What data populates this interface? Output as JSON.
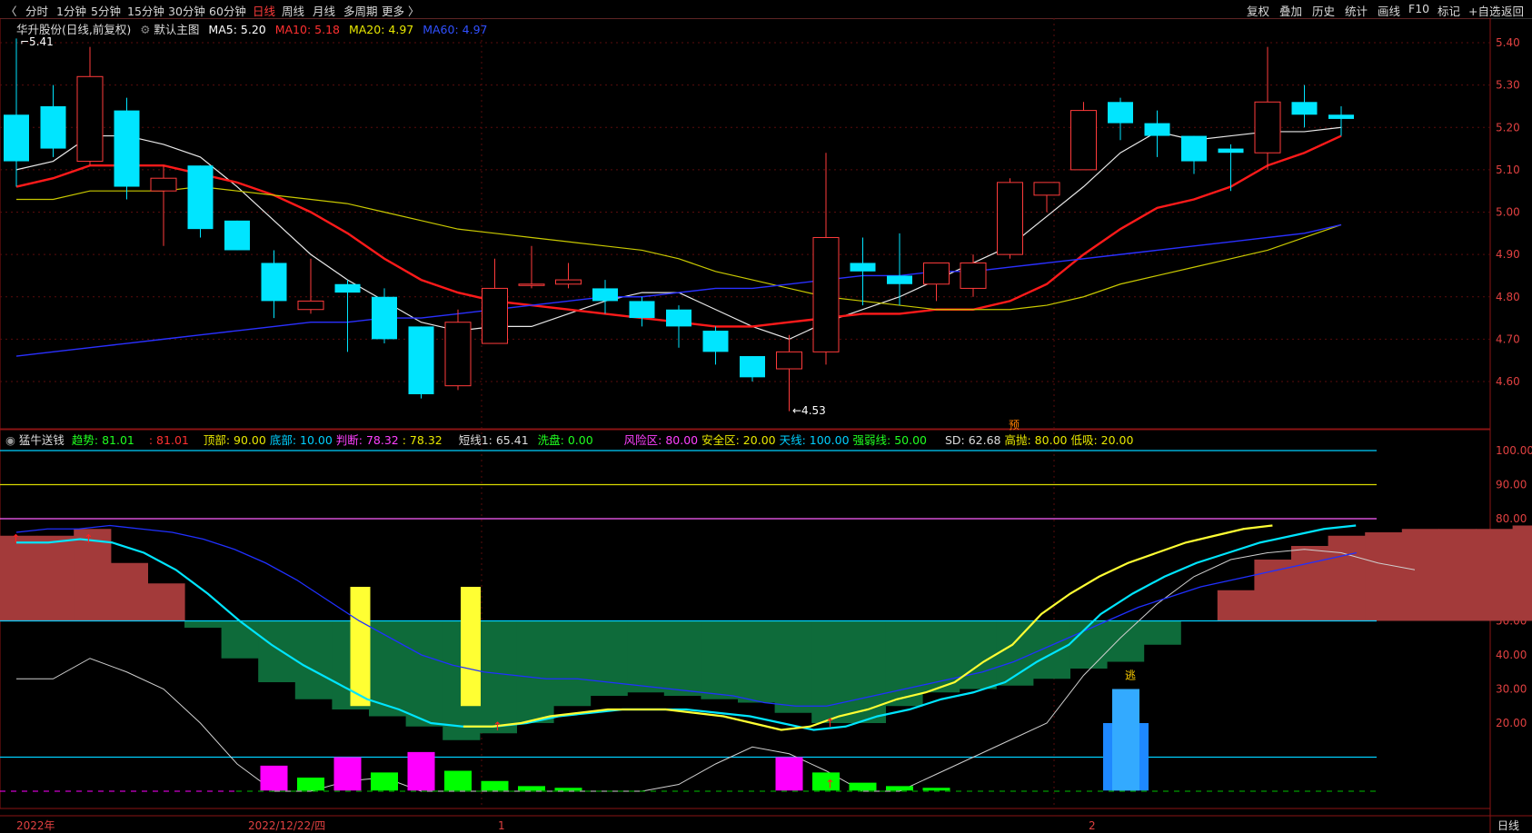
{
  "toolbar": {
    "tabs": [
      {
        "label": "分时",
        "active": false
      },
      {
        "label": "1分钟",
        "active": false
      },
      {
        "label": "5分钟",
        "active": false
      },
      {
        "label": "15分钟",
        "active": false
      },
      {
        "label": "30分钟",
        "active": false
      },
      {
        "label": "60分钟",
        "active": false
      },
      {
        "label": "日线",
        "active": true
      },
      {
        "label": "周线",
        "active": false
      },
      {
        "label": "月线",
        "active": false
      },
      {
        "label": "多周期",
        "active": false
      },
      {
        "label": "更多 〉",
        "active": false
      }
    ],
    "right_tabs": [
      "复权",
      "叠加",
      "历史",
      "统计",
      "画线",
      "F10",
      "标记",
      "+自选",
      "返回"
    ]
  },
  "header": {
    "stock_name": "华升股份(日线,前复权)",
    "chart_label": "默认主图",
    "ma5": "MA5: 5.20",
    "ma10": "MA10: 5.18",
    "ma20": "MA20: 4.97",
    "ma60": "MA60: 4.97"
  },
  "indicator_legend": {
    "name": "猛牛送钱",
    "trend": "趋势: 81.01",
    "trend2": ": 81.01",
    "top": "顶部: 90.00",
    "bottom": "底部: 10.00",
    "judge": "判断: 78.32",
    "judge2": ": 78.32",
    "short": "短线1: 65.41",
    "wash": "洗盘: 0.00",
    "risk": "风险区: 80.00",
    "safe": "安全区: 20.00",
    "sky": "天线: 100.00",
    "strongweak": "强弱线: 50.00",
    "sd": "SD: 62.68",
    "high": "高抛: 80.00",
    "low": "低吸: 20.00"
  },
  "annotations": {
    "high_label": "5.41",
    "low_label": "4.53",
    "yu_label": "预",
    "tao_label": "逃"
  },
  "bottom_axis": {
    "labels": [
      "2022年",
      "2022/12/22/四",
      "1",
      "2"
    ],
    "period": "日线"
  },
  "colors": {
    "up": "#ff3b3b",
    "down": "#00e5ff",
    "ma5": "#ffffff",
    "ma10": "#ff2020",
    "ma20": "#d8d800",
    "ma60": "#2030ff",
    "risk_fill": "#a33a3a",
    "safe_fill": "#0e6b3a",
    "grid": "#7a1010"
  },
  "chart_data": [
    {
      "type": "candlestick",
      "title": "华升股份(日线,前复权)",
      "ylim": [
        4.53,
        5.45
      ],
      "yticks": [
        4.6,
        4.7,
        4.8,
        4.9,
        5.0,
        5.1,
        5.2,
        5.3,
        5.4
      ],
      "candles": [
        {
          "o": 5.23,
          "h": 5.41,
          "l": 5.06,
          "c": 5.12
        },
        {
          "o": 5.25,
          "h": 5.3,
          "l": 5.13,
          "c": 5.15
        },
        {
          "o": 5.12,
          "h": 5.39,
          "l": 5.11,
          "c": 5.32
        },
        {
          "o": 5.24,
          "h": 5.27,
          "l": 5.03,
          "c": 5.06
        },
        {
          "o": 5.05,
          "h": 5.11,
          "l": 4.92,
          "c": 5.08
        },
        {
          "o": 5.11,
          "h": 5.11,
          "l": 4.94,
          "c": 4.96
        },
        {
          "o": 4.98,
          "h": 4.98,
          "l": 4.91,
          "c": 4.91
        },
        {
          "o": 4.88,
          "h": 4.91,
          "l": 4.75,
          "c": 4.79
        },
        {
          "o": 4.77,
          "h": 4.89,
          "l": 4.76,
          "c": 4.79
        },
        {
          "o": 4.83,
          "h": 4.84,
          "l": 4.67,
          "c": 4.81
        },
        {
          "o": 4.8,
          "h": 4.82,
          "l": 4.69,
          "c": 4.7
        },
        {
          "o": 4.73,
          "h": 4.73,
          "l": 4.56,
          "c": 4.57
        },
        {
          "o": 4.59,
          "h": 4.77,
          "l": 4.58,
          "c": 4.74
        },
        {
          "o": 4.69,
          "h": 4.89,
          "l": 4.69,
          "c": 4.82
        },
        {
          "o": 4.83,
          "h": 4.92,
          "l": 4.82,
          "c": 4.83
        },
        {
          "o": 4.83,
          "h": 4.88,
          "l": 4.82,
          "c": 4.84
        },
        {
          "o": 4.82,
          "h": 4.84,
          "l": 4.76,
          "c": 4.79
        },
        {
          "o": 4.79,
          "h": 4.8,
          "l": 4.73,
          "c": 4.75
        },
        {
          "o": 4.77,
          "h": 4.78,
          "l": 4.68,
          "c": 4.73
        },
        {
          "o": 4.72,
          "h": 4.73,
          "l": 4.64,
          "c": 4.67
        },
        {
          "o": 4.66,
          "h": 4.66,
          "l": 4.6,
          "c": 4.61
        },
        {
          "o": 4.63,
          "h": 4.71,
          "l": 4.53,
          "c": 4.67
        },
        {
          "o": 4.67,
          "h": 5.14,
          "l": 4.64,
          "c": 4.94
        },
        {
          "o": 4.88,
          "h": 4.94,
          "l": 4.78,
          "c": 4.86
        },
        {
          "o": 4.85,
          "h": 4.95,
          "l": 4.78,
          "c": 4.83
        },
        {
          "o": 4.83,
          "h": 4.88,
          "l": 4.79,
          "c": 4.88
        },
        {
          "o": 4.82,
          "h": 4.9,
          "l": 4.8,
          "c": 4.88
        },
        {
          "o": 4.9,
          "h": 5.08,
          "l": 4.89,
          "c": 5.07
        },
        {
          "o": 5.04,
          "h": 5.07,
          "l": 5.0,
          "c": 5.07
        },
        {
          "o": 5.1,
          "h": 5.26,
          "l": 5.1,
          "c": 5.24
        },
        {
          "o": 5.26,
          "h": 5.27,
          "l": 5.17,
          "c": 5.21
        },
        {
          "o": 5.21,
          "h": 5.24,
          "l": 5.13,
          "c": 5.18
        },
        {
          "o": 5.18,
          "h": 5.18,
          "l": 5.09,
          "c": 5.12
        },
        {
          "o": 5.15,
          "h": 5.16,
          "l": 5.05,
          "c": 5.14
        },
        {
          "o": 5.14,
          "h": 5.39,
          "l": 5.1,
          "c": 5.26
        },
        {
          "o": 5.26,
          "h": 5.3,
          "l": 5.2,
          "c": 5.23
        },
        {
          "o": 5.23,
          "h": 5.25,
          "l": 5.18,
          "c": 5.22
        }
      ],
      "series": [
        {
          "name": "MA5",
          "values": [
            5.1,
            5.12,
            5.18,
            5.18,
            5.16,
            5.13,
            5.06,
            4.98,
            4.9,
            4.84,
            4.79,
            4.74,
            4.72,
            4.73,
            4.73,
            4.76,
            4.79,
            4.81,
            4.81,
            4.77,
            4.73,
            4.7,
            4.74,
            4.77,
            4.8,
            4.84,
            4.88,
            4.92,
            4.99,
            5.06,
            5.14,
            5.19,
            5.17,
            5.18,
            5.19,
            5.19,
            5.2
          ]
        },
        {
          "name": "MA10",
          "values": [
            5.06,
            5.08,
            5.11,
            5.11,
            5.11,
            5.09,
            5.07,
            5.04,
            5.0,
            4.95,
            4.89,
            4.84,
            4.81,
            4.79,
            4.78,
            4.77,
            4.76,
            4.75,
            4.74,
            4.73,
            4.73,
            4.74,
            4.75,
            4.76,
            4.76,
            4.77,
            4.77,
            4.79,
            4.83,
            4.9,
            4.96,
            5.01,
            5.03,
            5.06,
            5.11,
            5.14,
            5.18
          ]
        },
        {
          "name": "MA20",
          "values": [
            5.03,
            5.03,
            5.05,
            5.05,
            5.05,
            5.06,
            5.05,
            5.04,
            5.03,
            5.02,
            5.0,
            4.98,
            4.96,
            4.95,
            4.94,
            4.93,
            4.92,
            4.91,
            4.89,
            4.86,
            4.84,
            4.82,
            4.8,
            4.79,
            4.78,
            4.77,
            4.77,
            4.77,
            4.78,
            4.8,
            4.83,
            4.85,
            4.87,
            4.89,
            4.91,
            4.94,
            4.97
          ]
        },
        {
          "name": "MA60",
          "values": [
            4.66,
            4.67,
            4.68,
            4.69,
            4.7,
            4.71,
            4.72,
            4.73,
            4.74,
            4.74,
            4.75,
            4.75,
            4.76,
            4.77,
            4.78,
            4.79,
            4.8,
            4.8,
            4.81,
            4.82,
            4.82,
            4.83,
            4.84,
            4.85,
            4.85,
            4.86,
            4.86,
            4.87,
            4.88,
            4.89,
            4.9,
            4.91,
            4.92,
            4.93,
            4.94,
            4.95,
            4.97
          ]
        }
      ]
    },
    {
      "type": "indicator",
      "title": "猛牛送钱",
      "ylim": [
        0,
        105
      ],
      "yticks": [
        20,
        30,
        40,
        50,
        60,
        70,
        80,
        90,
        100
      ],
      "hlines": [
        {
          "y": 100,
          "color": "#00d0ff"
        },
        {
          "y": 90,
          "color": "#d8d800"
        },
        {
          "y": 80,
          "color": "#ff60ff"
        },
        {
          "y": 50,
          "color": "#00d0ff"
        },
        {
          "y": 10,
          "color": "#00d0ff"
        }
      ],
      "step_values": [
        75,
        75,
        77,
        67,
        61,
        48,
        39,
        32,
        27,
        24,
        22,
        19,
        15,
        17,
        20,
        25,
        28,
        29,
        28,
        27,
        26,
        23,
        20,
        20,
        25,
        29,
        30,
        31,
        33,
        36,
        38,
        43,
        50,
        59,
        68,
        72,
        75,
        76,
        77,
        77,
        77,
        78,
        77,
        77,
        77,
        75
      ],
      "judge_values": [
        73,
        73,
        74,
        73,
        70,
        65,
        58,
        50,
        43,
        37,
        32,
        27,
        24,
        20,
        19,
        19,
        20,
        22,
        23,
        24,
        24,
        24,
        23,
        22,
        20,
        18,
        19,
        22,
        24,
        27,
        29,
        32,
        38,
        43,
        52,
        58,
        63,
        67,
        70,
        73,
        75,
        77,
        78
      ],
      "trend_values": [
        76,
        77,
        77,
        78,
        77,
        76,
        74,
        71,
        67,
        62,
        56,
        50,
        45,
        40,
        37,
        35,
        34,
        33,
        33,
        32,
        31,
        30,
        29,
        28,
        26,
        25,
        25,
        27,
        29,
        31,
        33,
        35,
        38,
        42,
        46,
        50,
        54,
        57,
        60,
        62,
        64,
        66,
        68,
        70
      ],
      "short_values": [
        33,
        33,
        39,
        35,
        30,
        20,
        8,
        0,
        0,
        3,
        4,
        0,
        0,
        0,
        0,
        0,
        0,
        0,
        2,
        8,
        13,
        11,
        6,
        0,
        0,
        5,
        10,
        15,
        20,
        34,
        45,
        55,
        63,
        68,
        70,
        71,
        70,
        67,
        65
      ],
      "yellow_bars": [
        {
          "bar": 9,
          "top": 60,
          "bottom": 25
        },
        {
          "bar": 12,
          "top": 60,
          "bottom": 25
        }
      ],
      "volume_bars": [
        {
          "bar": 7,
          "v": 7.5,
          "color": "#ff00ff"
        },
        {
          "bar": 8,
          "v": 4,
          "color": "#00ff00"
        },
        {
          "bar": 9,
          "v": 10,
          "color": "#ff00ff"
        },
        {
          "bar": 10,
          "v": 5.5,
          "color": "#00ff00"
        },
        {
          "bar": 11,
          "v": 11.5,
          "color": "#ff00ff"
        },
        {
          "bar": 12,
          "v": 6,
          "color": "#00ff00"
        },
        {
          "bar": 13,
          "v": 3,
          "color": "#00ff00"
        },
        {
          "bar": 14,
          "v": 1.5,
          "color": "#00ff00"
        },
        {
          "bar": 15,
          "v": 1,
          "color": "#00ff00"
        },
        {
          "bar": 21,
          "v": 10,
          "color": "#ff00ff"
        },
        {
          "bar": 22,
          "v": 5.5,
          "color": "#00ff00"
        },
        {
          "bar": 23,
          "v": 2.5,
          "color": "#00ff00"
        },
        {
          "bar": 24,
          "v": 1.5,
          "color": "#00ff00"
        },
        {
          "bar": 25,
          "v": 1,
          "color": "#00ff00"
        }
      ],
      "blue_bars": [
        {
          "bar": 29.5,
          "v": 20
        },
        {
          "bar": 30,
          "v": 30
        }
      ]
    }
  ]
}
